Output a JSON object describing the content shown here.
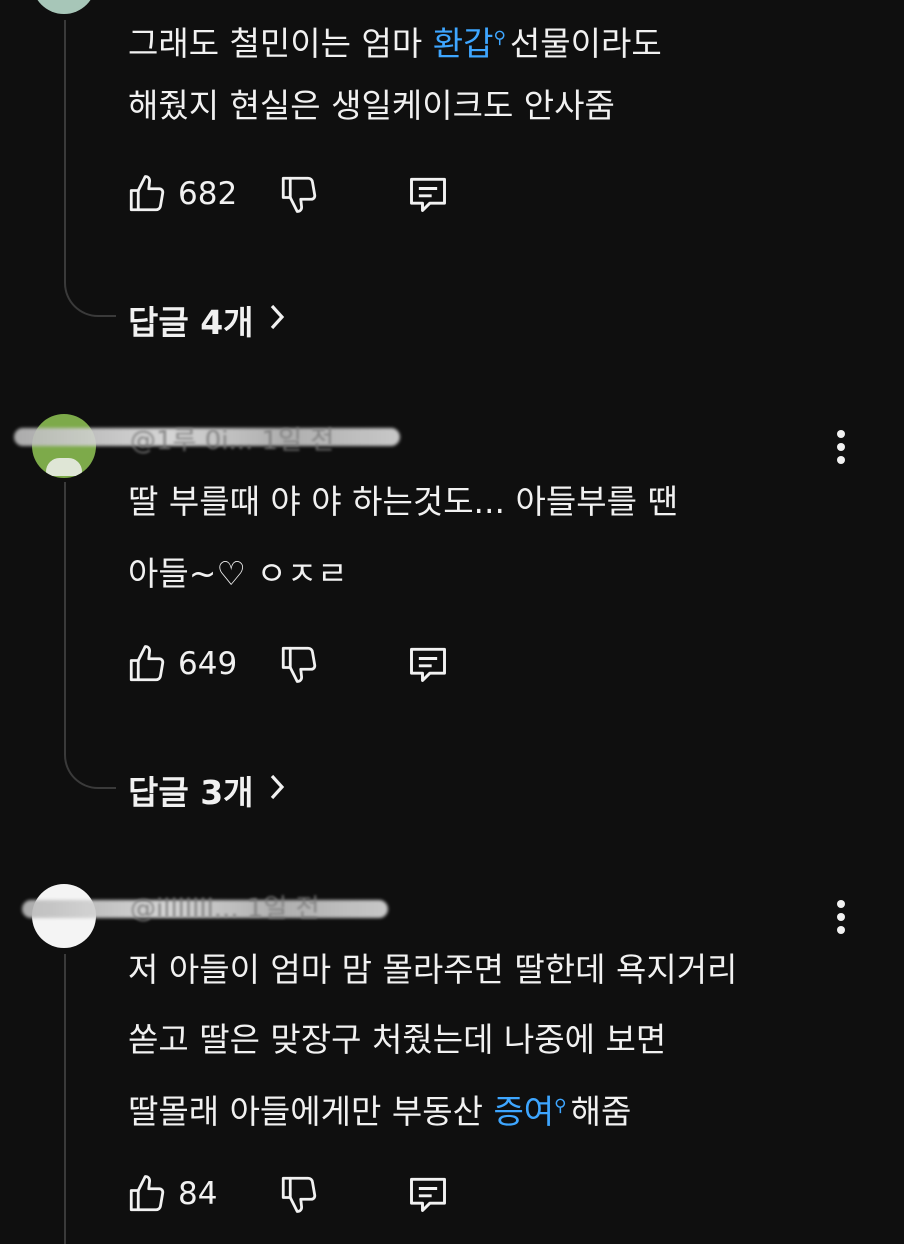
{
  "comments": [
    {
      "text_lines": [
        "그래도 철민이는 엄마 ",
        "선물이라도",
        "해줬지 현실은 생일케이크도 안사줌"
      ],
      "link": "환갑",
      "likes": "682",
      "replies_label": "답글 4개"
    },
    {
      "author": "@1루 0i... 1일 전",
      "text_lines": [
        "딸 부를때 야 야 하는것도... 아들부를 땐",
        "아들~♡ ㅇㅈㄹ"
      ],
      "likes": "649",
      "replies_label": "답글 3개"
    },
    {
      "author": "@illlllll... 1일 전",
      "text_lines": [
        "저 아들이 엄마 맘 몰라주면 딸한데 욕지거리",
        "쏟고 딸은 맞장구 처줬는데 나중에 보면",
        "딸몰래 아들에게만 부동산 ",
        "해줌"
      ],
      "link": "증여",
      "likes": "84"
    }
  ],
  "icons": {
    "like": "thumbs-up-icon",
    "dislike": "thumbs-down-icon",
    "reply": "comment-icon",
    "more": "more-vertical-icon",
    "search": "search-mini-icon"
  },
  "colors": {
    "background": "#0f0f0f",
    "text": "#f1f1f1",
    "link": "#3ea6ff"
  }
}
